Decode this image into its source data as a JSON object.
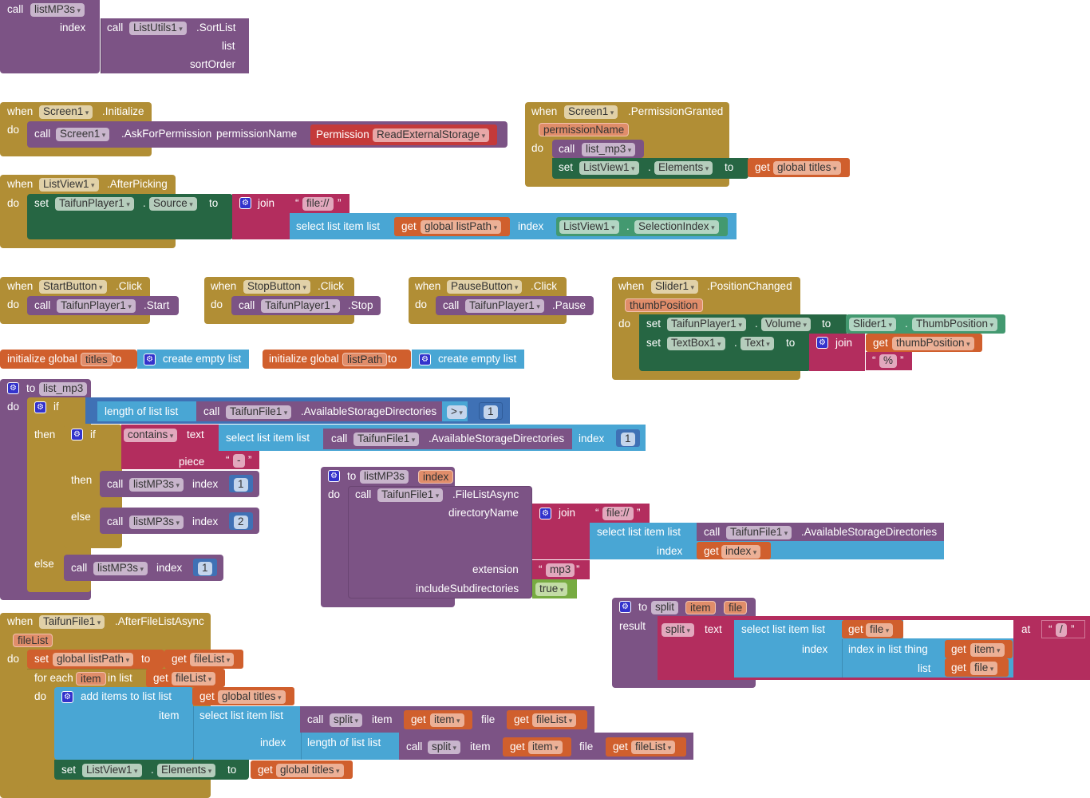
{
  "kw": {
    "call": "call",
    "when": "when",
    "do": "do",
    "set": "set",
    "to": "to",
    "get": "get",
    "dot": ".",
    "join": "join",
    "if": "if",
    "then": "then",
    "else": "else",
    "result": "result",
    "index": "index",
    "list": "list",
    "item": "item",
    "file": "file",
    "text": "text",
    "piece": "piece",
    "at": "at",
    "thing": "thing",
    "in_list": "in list",
    "for_each": "for each",
    "quote_open": "“",
    "quote_close": "”",
    "select_list_item": "select list item  list",
    "length_of_list": "length of list  list",
    "index_in_list": "index in list  thing",
    "add_items_to_list": "add items to list  list",
    "create_empty_list": "create empty list",
    "initialize_global": "initialize global"
  },
  "blocks": {
    "call_listmp3s_sort": {
      "procedure": "listMP3s",
      "param": "index",
      "component": "ListUtils1",
      "method": ".SortList",
      "args": [
        "list",
        "sortOrder"
      ]
    },
    "screen_initialize": {
      "component": "Screen1",
      "event": ".Initialize",
      "call_component": "Screen1",
      "call_method": ".AskForPermission",
      "arg_label": "permissionName",
      "permission_label": "Permission",
      "permission_value": "ReadExternalStorage"
    },
    "permission_granted": {
      "component": "Screen1",
      "event": ".PermissionGranted",
      "param": "permissionName",
      "call_procedure": "list_mp3",
      "set_component": "ListView1",
      "set_property": "Elements",
      "get_var": "global titles"
    },
    "listview_afterpicking": {
      "component": "ListView1",
      "event": ".AfterPicking",
      "set_component": "TaifunPlayer1",
      "set_property": "Source",
      "text_literal": "file://",
      "get_var": "global listPath",
      "index_component": "ListView1",
      "index_property": "SelectionIndex"
    },
    "start_click": {
      "component": "StartButton",
      "event": ".Click",
      "call_component": "TaifunPlayer1",
      "call_method": ".Start"
    },
    "stop_click": {
      "component": "StopButton",
      "event": ".Click",
      "call_component": "TaifunPlayer1",
      "call_method": ".Stop"
    },
    "pause_click": {
      "component": "PauseButton",
      "event": ".Click",
      "call_component": "TaifunPlayer1",
      "call_method": ".Pause"
    },
    "slider_changed": {
      "component": "Slider1",
      "event": ".PositionChanged",
      "param": "thumbPosition",
      "set1_component": "TaifunPlayer1",
      "set1_property": "Volume",
      "get_component": "Slider1",
      "get_property": "ThumbPosition",
      "set2_component": "TextBox1",
      "set2_property": "Text",
      "get_var": "thumbPosition",
      "text_literal": "%"
    },
    "init_titles": {
      "name": "titles"
    },
    "init_listpath": {
      "name": "listPath"
    },
    "proc_list_mp3": {
      "name": "list_mp3",
      "component": "TaifunFile1",
      "method": ".AvailableStorageDirectories",
      "compare_op": ">",
      "compare_value": "1",
      "contains_op": "contains",
      "piece_literal": "-",
      "select_index": "1",
      "call_procedure": "listMP3s",
      "then_index": "1",
      "else_index": "2",
      "outer_else_index": "1"
    },
    "proc_listmp3s": {
      "name": "listMP3s",
      "param": "index",
      "component": "TaifunFile1",
      "method": ".FileListAsync",
      "arg_directory": "directoryName",
      "arg_extension": "extension",
      "arg_subdirs": "includeSubdirectories",
      "text_literal": "file://",
      "dirs_component": "TaifunFile1",
      "dirs_method": ".AvailableStorageDirectories",
      "get_var": "index",
      "ext_literal": "mp3",
      "subdirs_value": "true"
    },
    "proc_split": {
      "name": "split",
      "params": [
        "item",
        "file"
      ],
      "split_op": "split",
      "get_file": "file",
      "get_item": "item",
      "sep_literal": "/"
    },
    "after_file_list": {
      "component": "TaifunFile1",
      "event": ".AfterFileListAsync",
      "param": "fileList",
      "set_var": "global listPath",
      "get_var": "fileList",
      "loop_var": "item",
      "titles_var": "global titles",
      "split_proc": "split",
      "get_item": "item",
      "get_filelist": "fileList",
      "set_component": "ListView1",
      "set_property": "Elements"
    }
  }
}
